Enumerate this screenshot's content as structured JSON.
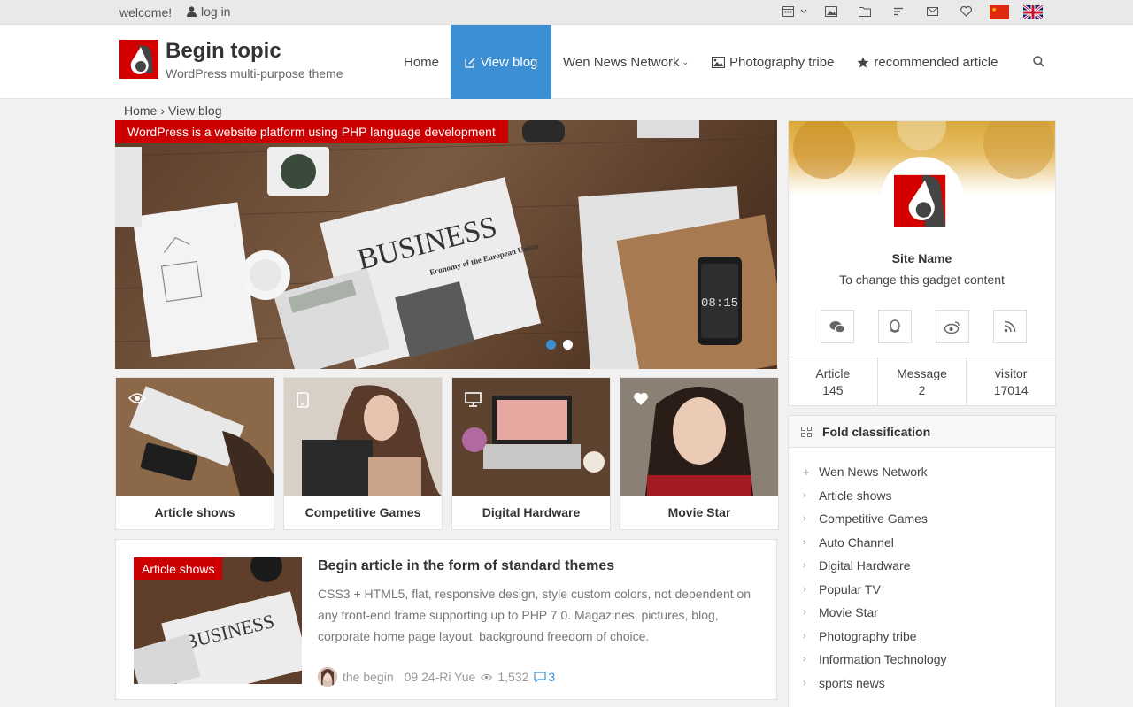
{
  "topbar": {
    "welcome": "welcome!",
    "login": "log in",
    "icons": [
      "calendar-icon",
      "image-icon",
      "folder-icon",
      "list-icon",
      "mail-icon",
      "heart-icon"
    ]
  },
  "header": {
    "title": "Begin topic",
    "subtitle": "WordPress multi-purpose theme",
    "nav": [
      {
        "label": "Home"
      },
      {
        "label": "View blog",
        "active": true
      },
      {
        "label": "Wen News Network"
      },
      {
        "label": "Photography tribe"
      },
      {
        "label": "recommended article"
      }
    ]
  },
  "breadcrumb": {
    "home": "Home",
    "sep": "›",
    "current": "View blog"
  },
  "slider": {
    "title": "WordPress is a website platform using PHP language development",
    "image_text": {
      "newspaper": "BUSINESS",
      "headline": "Economy of the European Union",
      "phone_time": "08:15"
    }
  },
  "cards": [
    {
      "label": "Article shows",
      "icon": "eye-icon"
    },
    {
      "label": "Competitive Games",
      "icon": "tablet-icon"
    },
    {
      "label": "Digital Hardware",
      "icon": "monitor-icon"
    },
    {
      "label": "Movie Star",
      "icon": "heart-icon"
    }
  ],
  "article": {
    "category": "Article shows",
    "title": "Begin article in the form of standard themes",
    "excerpt": "CSS3 + HTML5, flat, responsive design, style custom colors, not dependent on any front-end frame supporting up to PHP 7.0. Magazines, pictures, blog, corporate home page layout, background freedom of choice.",
    "author": "the begin",
    "date": "09 24-Ri Yue",
    "views": "1,532",
    "comments": "3"
  },
  "profile": {
    "name": "Site Name",
    "desc": "To change this gadget content",
    "stats": [
      {
        "label": "Article",
        "value": "145"
      },
      {
        "label": "Message",
        "value": "2"
      },
      {
        "label": "visitor",
        "value": "17014"
      }
    ]
  },
  "fold": {
    "title": "Fold classification",
    "items": [
      "Wen News Network",
      "Article shows",
      "Competitive Games",
      "Auto Channel",
      "Digital Hardware",
      "Popular TV",
      "Movie Star",
      "Photography tribe",
      "Information Technology",
      "sports news"
    ]
  },
  "colors": {
    "accent": "#3c8fd2",
    "brand_red": "#cc0000",
    "background": "#f1f1f1"
  }
}
